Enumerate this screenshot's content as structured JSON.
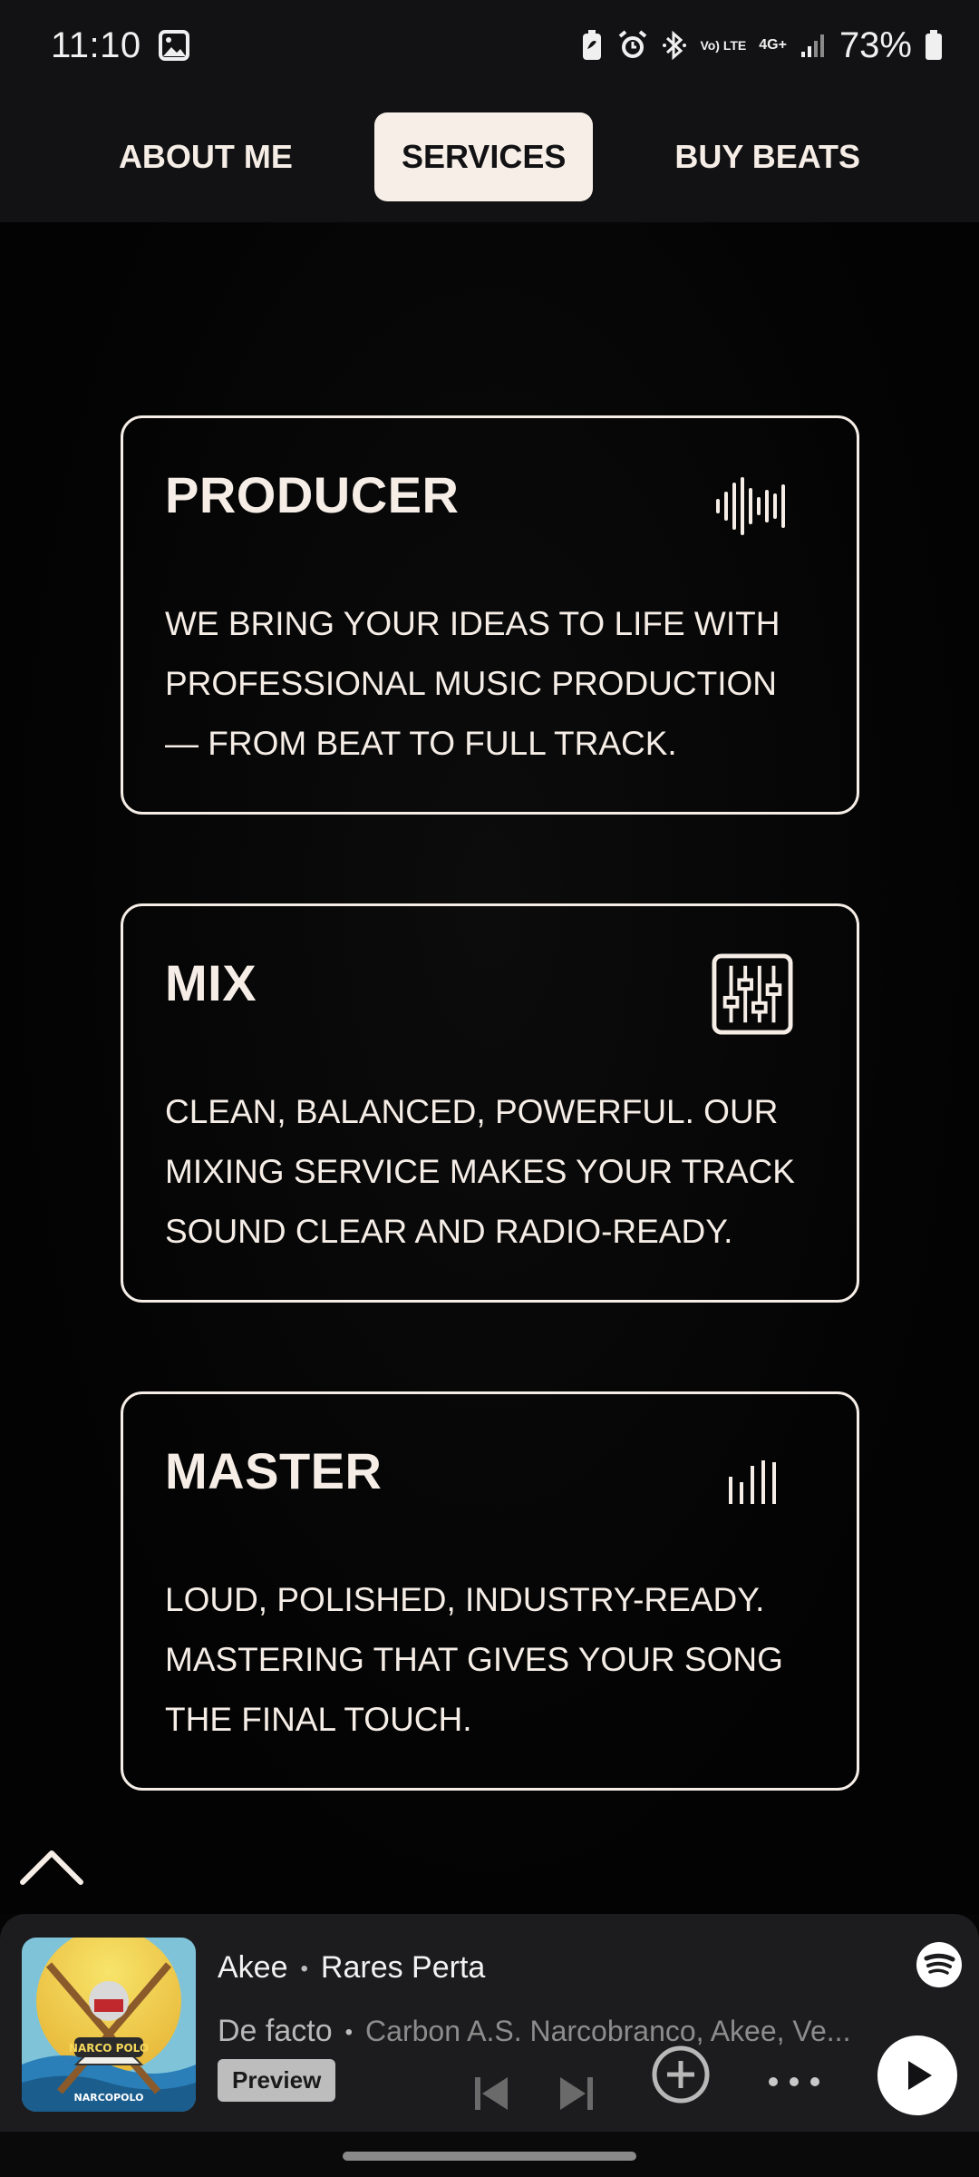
{
  "status_bar": {
    "time": "11:10",
    "battery_percent": "73%",
    "network": "4G+",
    "volte": "Vo) LTE",
    "icons": [
      "gallery-icon",
      "battery-saver-icon",
      "alarm-icon",
      "bluetooth-icon",
      "signal-icon",
      "battery-icon"
    ]
  },
  "nav": {
    "items": [
      {
        "label": "ABOUT ME",
        "active": false
      },
      {
        "label": "SERVICES",
        "active": true
      },
      {
        "label": "BUY BEATS",
        "active": false
      }
    ]
  },
  "services": [
    {
      "title": "PRODUCER",
      "icon": "waveform-icon",
      "description": "WE BRING YOUR IDEAS TO LIFE WITH PROFESSIONAL MUSIC PRODUCTION — FROM BEAT TO FULL TRACK."
    },
    {
      "title": "MIX",
      "icon": "mixer-sliders-icon",
      "description": "CLEAN, BALANCED, POWERFUL. OUR MIXING SERVICE MAKES YOUR TRACK SOUND CLEAR AND RADIO-READY."
    },
    {
      "title": "MASTER",
      "icon": "level-bars-icon",
      "description": "LOUD, POLISHED, INDUSTRY-READY. MASTERING THAT GIVES YOUR SONG THE FINAL TOUCH."
    }
  ],
  "player": {
    "artist_primary": "Akee",
    "artist_secondary": "Rares Perta",
    "track_title": "De facto",
    "track_subtitle": "Carbon A.S. Narcobranco, Akee, Ve...",
    "preview_label": "Preview",
    "cover_text": "NARCOPOLO",
    "colors": {
      "background": "#1c1c1e",
      "accent": "#ffffff"
    }
  },
  "colors": {
    "cream": "#f5ede6",
    "nav_bg": "#121214",
    "page_bg": "#050505"
  }
}
